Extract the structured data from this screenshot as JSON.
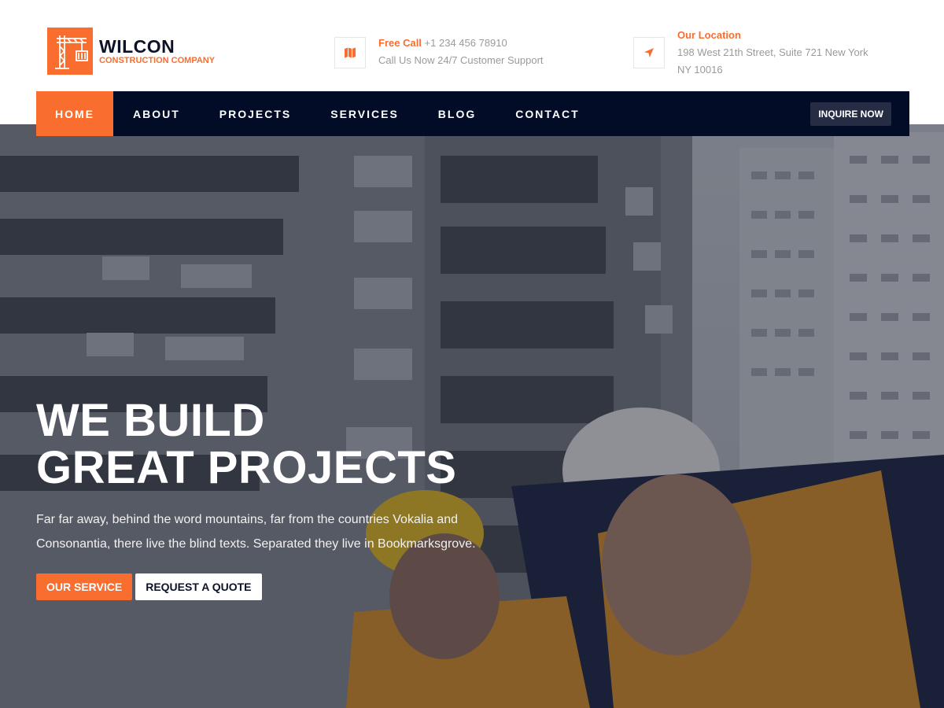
{
  "brand": {
    "name": "WILCON",
    "tagline": "CONSTRUCTION COMPANY",
    "icon": "crane-icon",
    "accent_color": "#f96d2e",
    "dark_color": "#020c27"
  },
  "header": {
    "phone": {
      "title": "Free Call",
      "number": "+1 234 456 78910",
      "subtitle": "Call Us Now 24/7 Customer Support",
      "icon": "map-icon"
    },
    "location": {
      "title": "Our Location",
      "address": "198 West 21th Street, Suite 721 New York NY 10016",
      "icon": "navigation-arrow-icon"
    }
  },
  "nav": {
    "items": [
      {
        "label": "HOME",
        "active": true
      },
      {
        "label": "ABOUT"
      },
      {
        "label": "PROJECTS"
      },
      {
        "label": "SERVICES"
      },
      {
        "label": "BLOG"
      },
      {
        "label": "CONTACT"
      }
    ],
    "cta": "INQUIRE NOW"
  },
  "hero": {
    "title_line1": "WE BUILD",
    "title_line2": "GREAT PROJECTS",
    "description": "Far far away, behind the word mountains, far from the countries Vokalia and Consonantia, there live the blind texts. Separated they live in Bookmarksgrove.",
    "primary_button": "OUR SERVICE",
    "secondary_button": "REQUEST A QUOTE"
  }
}
